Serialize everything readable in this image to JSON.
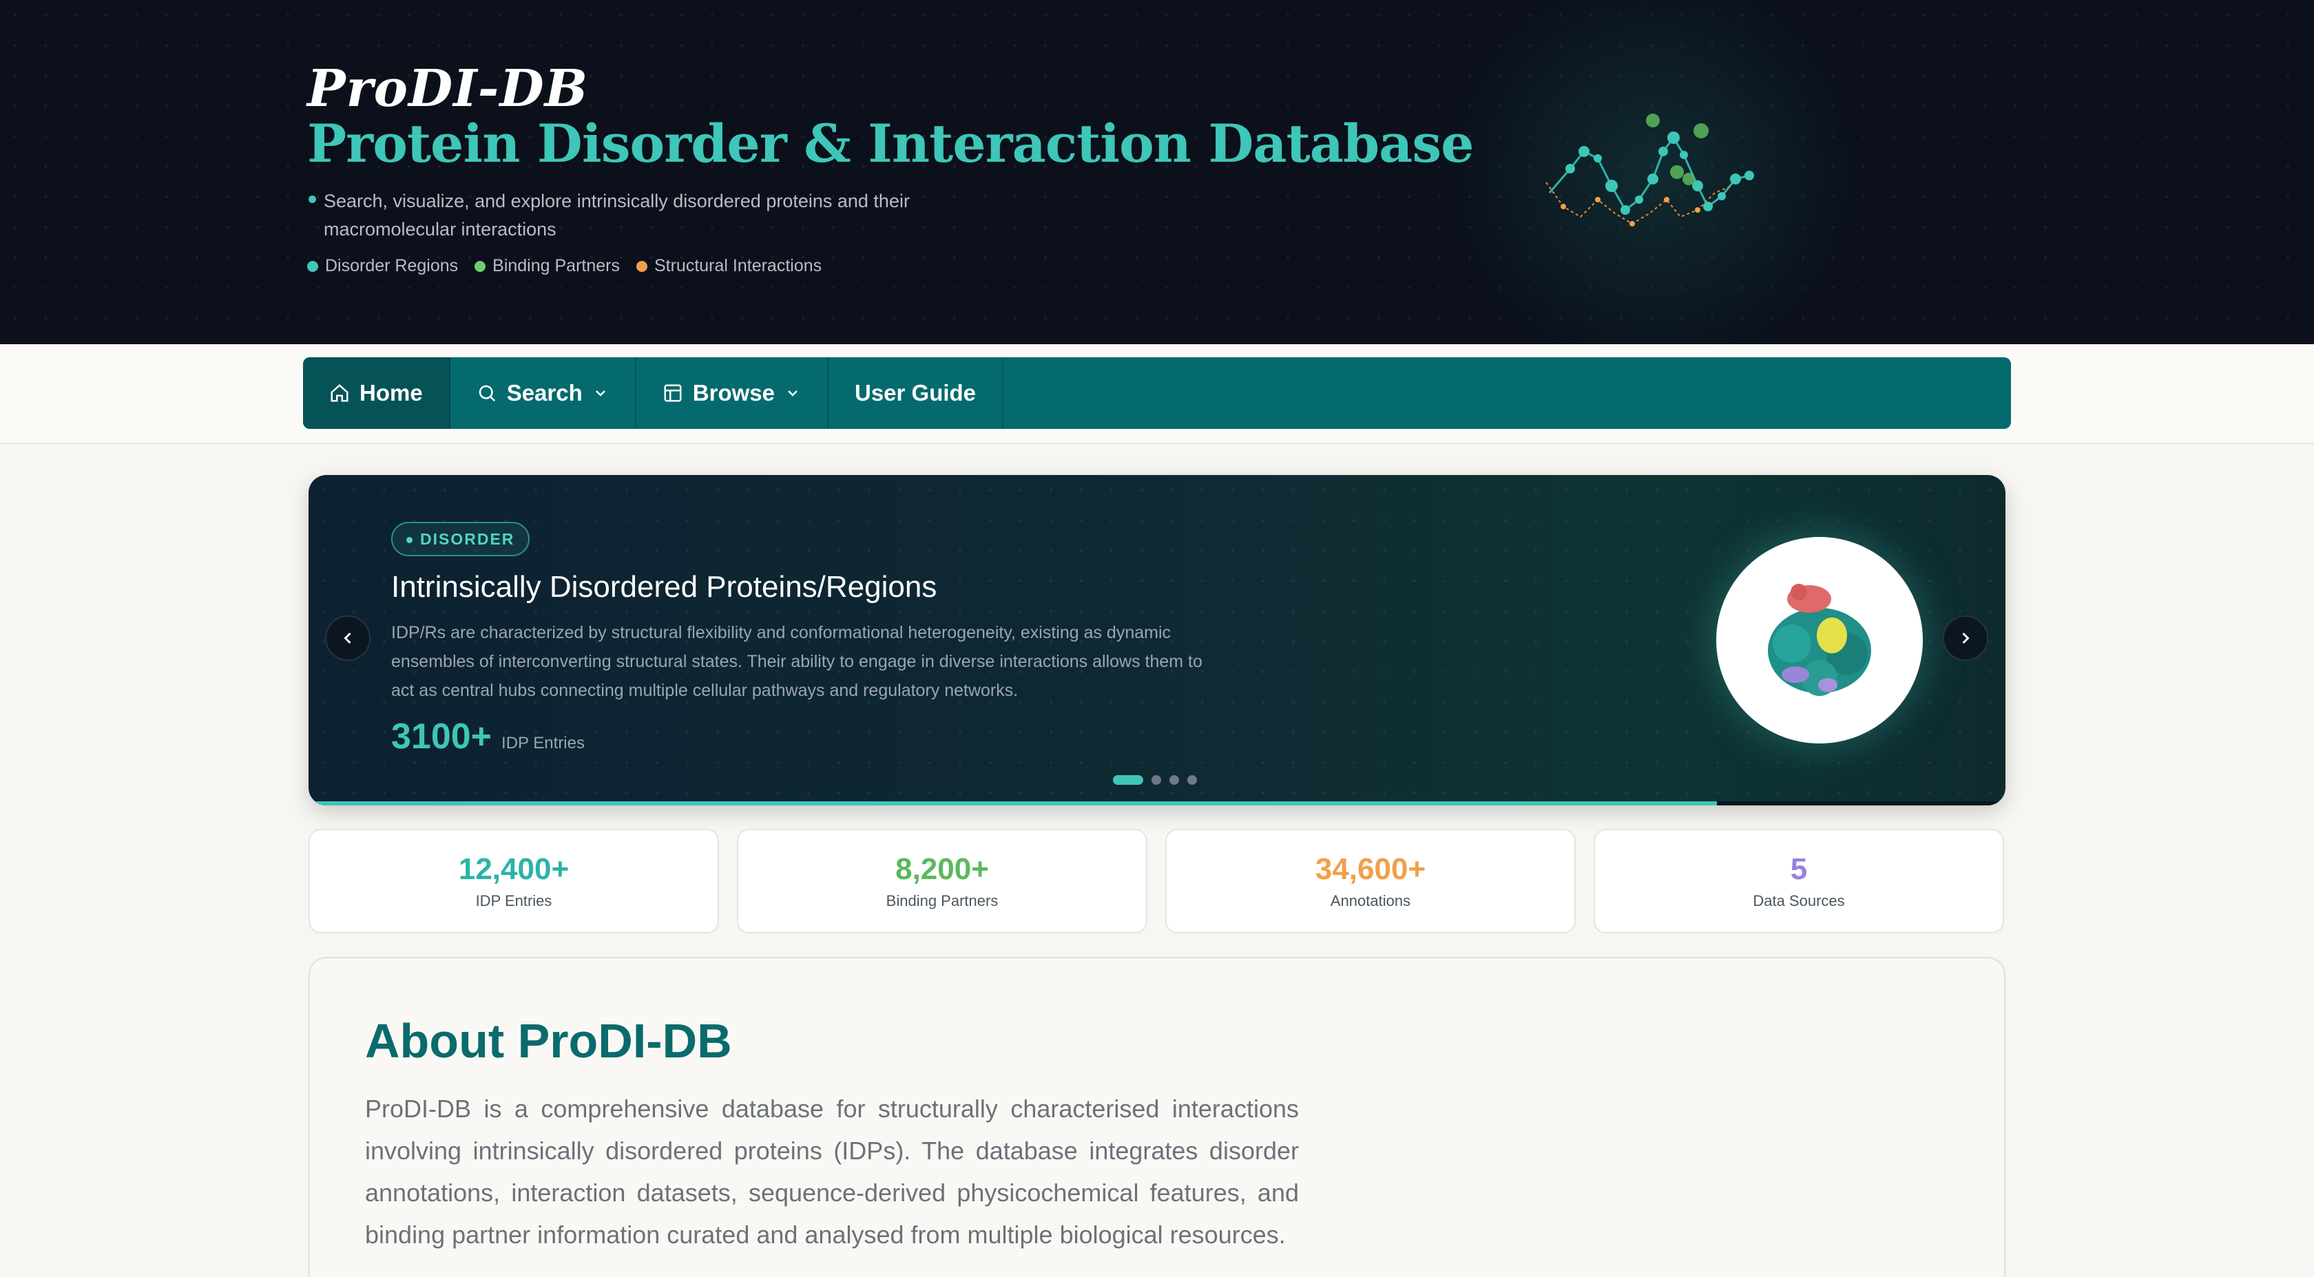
{
  "header": {
    "title": "ProDI-DB",
    "subtitle": "Protein Disorder & Interaction Database",
    "description": "Search, visualize, and explore intrinsically disordered proteins and their macromolecular interactions",
    "legend": [
      {
        "label": "Disorder Regions",
        "color": "#3ec6b8"
      },
      {
        "label": "Binding Partners",
        "color": "#6fcf6f"
      },
      {
        "label": "Structural Interactions",
        "color": "#f0a04b"
      }
    ]
  },
  "nav": {
    "items": [
      {
        "label": "Home",
        "icon": "home-icon"
      },
      {
        "label": "Search",
        "icon": "search-icon",
        "dropdown": true
      },
      {
        "label": "Browse",
        "icon": "browse-icon",
        "dropdown": true
      },
      {
        "label": "User Guide"
      }
    ]
  },
  "carousel": {
    "badge": "DISORDER",
    "title": "Intrinsically Disordered Proteins/Regions",
    "text": "IDP/Rs are characterized by structural flexibility and conformational heterogeneity, existing as dynamic ensembles of interconverting structural states. Their ability to engage in diverse interactions allows them to act as central hubs connecting multiple cellular pathways and regulatory networks.",
    "count": "3100+",
    "count_label": "IDP Entries",
    "slides_total": 4,
    "active_slide": 1,
    "progress": 0.83,
    "prev_icon": "chevron-left-icon",
    "next_icon": "chevron-right-icon"
  },
  "stats": [
    {
      "value": "12,400+",
      "label": "IDP Entries",
      "color": "#2bb3a8"
    },
    {
      "value": "8,200+",
      "label": "Binding Partners",
      "color": "#5cb85c"
    },
    {
      "value": "34,600+",
      "label": "Annotations",
      "color": "#f0a04b"
    },
    {
      "value": "5",
      "label": "Data Sources",
      "color": "#9b7fe0"
    }
  ],
  "about": {
    "heading": "About ProDI-DB",
    "text": "ProDI-DB is a comprehensive database for structurally characterised interactions involving intrinsically disordered proteins (IDPs). The database integrates disorder annotations, interaction datasets, sequence-derived physicochemical features, and binding partner information curated and analysed from multiple biological resources."
  }
}
